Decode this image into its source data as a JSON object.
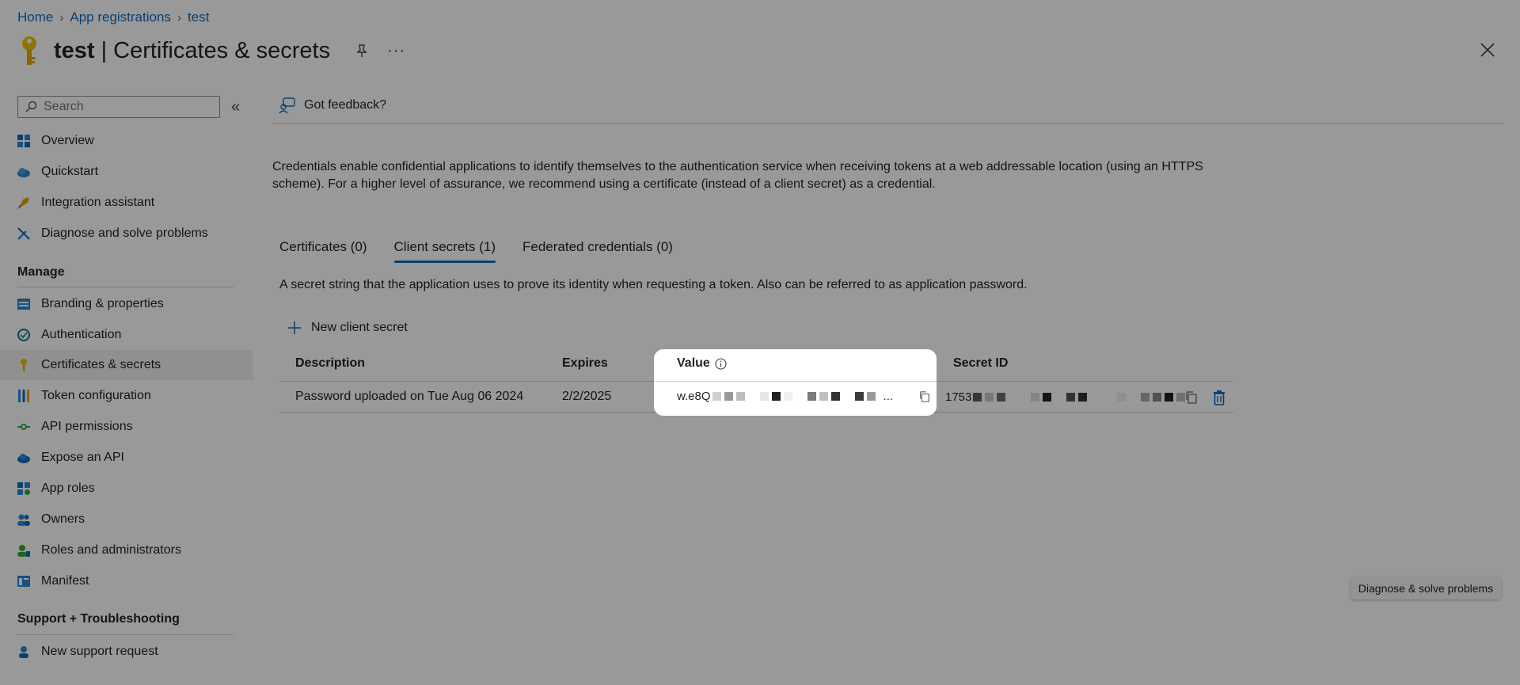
{
  "breadcrumb": {
    "items": [
      "Home",
      "App registrations",
      "test"
    ]
  },
  "header": {
    "app_name": "test",
    "separator": "|",
    "page_title": "Certificates & secrets",
    "more": "···"
  },
  "search": {
    "placeholder": "Search"
  },
  "sidebar": {
    "items": [
      {
        "label": "Overview",
        "icon": "overview-grid-icon"
      },
      {
        "label": "Quickstart",
        "icon": "cloud-icon"
      },
      {
        "label": "Integration assistant",
        "icon": "rocket-icon"
      },
      {
        "label": "Diagnose and solve problems",
        "icon": "wrench-icon"
      }
    ],
    "manage_title": "Manage",
    "manage_items": [
      {
        "label": "Branding & properties",
        "icon": "branding-icon"
      },
      {
        "label": "Authentication",
        "icon": "authentication-icon"
      },
      {
        "label": "Certificates & secrets",
        "icon": "key-icon",
        "active": true
      },
      {
        "label": "Token configuration",
        "icon": "token-bars-icon"
      },
      {
        "label": "API permissions",
        "icon": "api-permissions-icon"
      },
      {
        "label": "Expose an API",
        "icon": "cloud-api-icon"
      },
      {
        "label": "App roles",
        "icon": "app-roles-icon"
      },
      {
        "label": "Owners",
        "icon": "owners-icon"
      },
      {
        "label": "Roles and administrators",
        "icon": "roles-admin-icon"
      },
      {
        "label": "Manifest",
        "icon": "manifest-icon"
      }
    ],
    "support_title": "Support + Troubleshooting",
    "support_items": [
      {
        "label": "New support request",
        "icon": "support-person-icon"
      }
    ]
  },
  "main": {
    "feedback_label": "Got feedback?",
    "intro": "Credentials enable confidential applications to identify themselves to the authentication service when receiving tokens at a web addressable location (using an HTTPS scheme). For a higher level of assurance, we recommend using a certificate (instead of a client secret) as a credential.",
    "tabs": [
      "Certificates (0)",
      "Client secrets (1)",
      "Federated credentials (0)"
    ],
    "tab_description": "A secret string that the application uses to prove its identity when requesting a token. Also can be referred to as application password.",
    "new_secret_label": "New client secret",
    "columns": {
      "description": "Description",
      "expires": "Expires",
      "value": "Value",
      "secret_id": "Secret ID"
    },
    "rows": [
      {
        "description": "Password uploaded on Tue Aug 06 2024",
        "expires": "2/2/2025",
        "value_prefix": "w.e8Q",
        "value_ellipsis": "...",
        "secret_id_prefix": "1753"
      }
    ]
  },
  "diagnose_button": "Diagnose & solve problems",
  "colors": {
    "accent": "#0f6cbd",
    "key": "#e8b100",
    "delete": "#0f6cbd"
  }
}
